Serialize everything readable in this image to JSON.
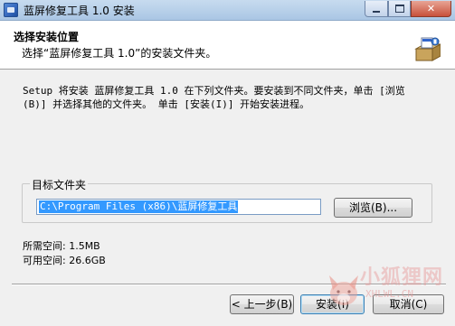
{
  "window": {
    "title": "蓝屏修复工具 1.0 安装",
    "close_glyph": "✕",
    "icon": "installer-app-icon"
  },
  "header": {
    "title": "选择安装位置",
    "subtitle": "选择“蓝屏修复工具 1.0”的安装文件夹。",
    "icon": "installer-box-icon"
  },
  "body": {
    "description_line1": "Setup 将安装 蓝屏修复工具 1.0 在下列文件夹。要安装到不同文件夹，单击 [浏览",
    "description_line2": "(B)] 并选择其他的文件夹。 单击 [安装(I)] 开始安装进程。"
  },
  "destination": {
    "group_label": "目标文件夹",
    "path_value": "C:\\Program Files (x86)\\蓝屏修复工具",
    "browse_label": "浏览(B)..."
  },
  "space": {
    "required": "所需空间: 1.5MB",
    "available": "可用空间: 26.6GB"
  },
  "footer": {
    "back_label": "< 上一步(B)",
    "install_label": "安装(I)",
    "cancel_label": "取消(C)"
  },
  "watermark": {
    "text": "小狐狸网",
    "subtext": "XHLWL.CN",
    "icon": "fox-logo-icon"
  },
  "colors": {
    "selection": "#3399ff",
    "window_bg": "#f0f0f0",
    "titlebar": "#aac6e4",
    "close_button": "#c8513b"
  }
}
